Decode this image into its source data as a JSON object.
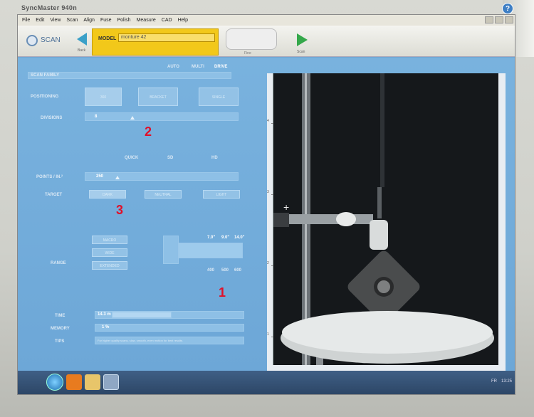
{
  "monitor": {
    "brand": "SyncMaster 940n"
  },
  "menu": [
    "File",
    "Edit",
    "View",
    "Scan",
    "Align",
    "Fuse",
    "Polish",
    "Measure",
    "CAD",
    "Help"
  ],
  "toolbar": {
    "scan_label": "SCAN",
    "back_label": "Back",
    "model_label": "MODEL",
    "model_value": "monture 42",
    "fine_label": "Fine",
    "start_label": "Scan"
  },
  "scan_family": {
    "header": "SCAN FAMILY",
    "modes": [
      "AUTO",
      "MULTI",
      "DRIVE"
    ],
    "positioning_label": "POSITIONING",
    "positioning_options": [
      "360",
      "BRACKET",
      "SINGLE"
    ],
    "divisions_label": "DIVISIONS",
    "divisions_value": "8"
  },
  "quality": {
    "levels": [
      "QUICK",
      "SD",
      "HD"
    ],
    "points_label": "POINTS / IN.²",
    "points_value": "250",
    "target_label": "TARGET",
    "target_options": [
      "DARK",
      "NEUTRAL",
      "LIGHT"
    ]
  },
  "range": {
    "label": "RANGE",
    "options": [
      "MACRO",
      "WIDE",
      "EXTENDED"
    ],
    "fov": [
      "7.0\"",
      "9.0\"",
      "14.0\""
    ],
    "dist": [
      "400",
      "500",
      "600"
    ]
  },
  "footer": {
    "time_label": "TIME",
    "time_value": "14.3 m",
    "memory_label": "MEMORY",
    "memory_value": "1 %",
    "tips_label": "TIPS",
    "tips_text": "For higher quality scans, slow, smooth, even motion for best results."
  },
  "annotations": [
    "1",
    "2",
    "3"
  ],
  "camera_scale": [
    "4",
    "3",
    "2",
    "1"
  ],
  "tray": {
    "lang": "FR",
    "time": "13:25"
  }
}
